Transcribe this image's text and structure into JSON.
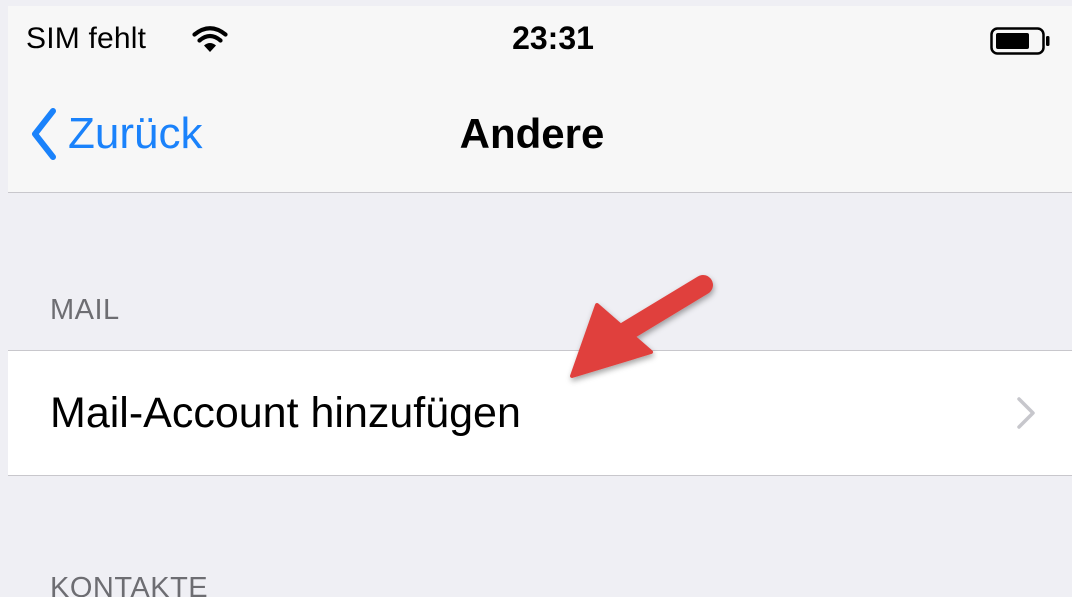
{
  "status_bar": {
    "carrier": "SIM fehlt",
    "time": "23:31",
    "wifi_icon": "wifi-icon",
    "battery_icon": "battery-icon"
  },
  "nav_bar": {
    "back_label": "Zurück",
    "back_icon": "chevron-left-icon",
    "title": "Andere"
  },
  "sections": [
    {
      "header": "MAIL",
      "items": [
        {
          "label": "Mail-Account hinzufügen",
          "icon": "chevron-right-icon"
        }
      ]
    },
    {
      "header": "KONTAKTE",
      "items": []
    }
  ],
  "annotation": {
    "icon": "red-arrow-icon",
    "color": "#e0413d"
  },
  "colors": {
    "ios_blue": "#1a82fb",
    "group_background": "#efeff4",
    "bar_background": "#f7f7f7",
    "separator": "#c8c7cc",
    "section_header_text": "#6d6d72"
  }
}
